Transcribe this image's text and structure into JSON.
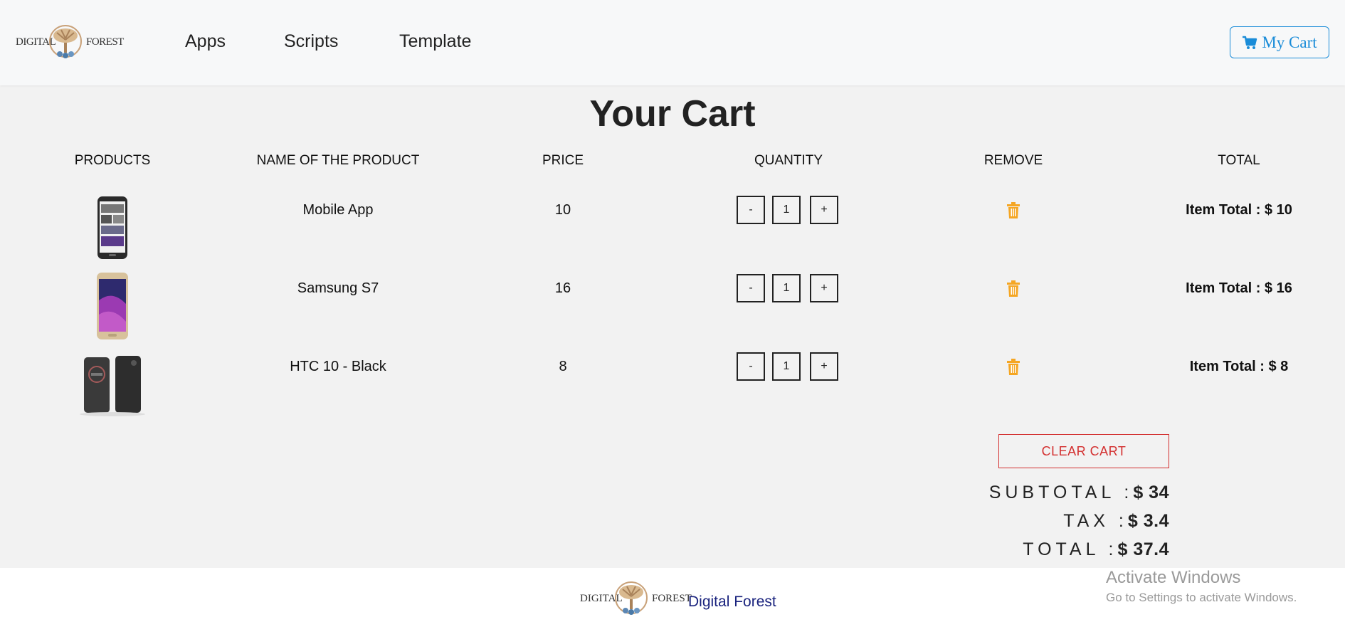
{
  "navbar": {
    "logo_left": "DIGITAL",
    "logo_right": "FOREST",
    "links": [
      "Apps",
      "Scripts",
      "Template"
    ],
    "cart_label": "My Cart",
    "cart_icon": "cart-icon"
  },
  "page_title": "Your Cart",
  "columns": [
    "PRODUCTS",
    "NAME OF THE PRODUCT",
    "PRICE",
    "QUANTITY",
    "REMOVE",
    "TOTAL"
  ],
  "items": [
    {
      "name": "Mobile App",
      "price": "10",
      "qty_minus": "-",
      "qty": "1",
      "qty_plus": "+",
      "total": "Item Total : $ 10",
      "image": "phone-app-thumbnail"
    },
    {
      "name": "Samsung S7",
      "price": "16",
      "qty_minus": "-",
      "qty": "1",
      "qty_plus": "+",
      "total": "Item Total : $ 16",
      "image": "samsung-thumbnail"
    },
    {
      "name": "HTC 10 - Black",
      "price": "8",
      "qty_minus": "-",
      "qty": "1",
      "qty_plus": "+",
      "total": "Item Total : $ 8",
      "image": "htc-thumbnail"
    }
  ],
  "summary": {
    "clear_label": "CLEAR CART",
    "subtotal_label": "SUBTOTAL :",
    "subtotal_value": "$ 34",
    "tax_label": "TAX :",
    "tax_value": "$ 3.4",
    "total_label": "TOTAL :",
    "total_value": "$ 37.4"
  },
  "footer": {
    "logo_left": "DIGITAL",
    "logo_right": "FOREST",
    "name": "Digital Forest"
  },
  "overlay": {
    "line1": "Activate Windows",
    "line2": "Go to Settings to activate Windows."
  },
  "colors": {
    "accent_blue": "#1a8cd8",
    "danger_red": "#d32f2f",
    "trash_orange": "#f5a623",
    "footer_text": "#1a237e"
  }
}
